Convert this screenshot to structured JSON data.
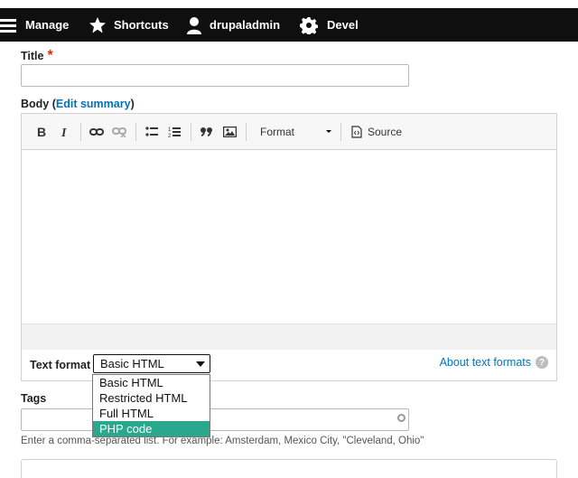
{
  "toolbar": {
    "manage": "Manage",
    "shortcuts": "Shortcuts",
    "user": "drupaladmin",
    "devel": "Devel"
  },
  "form": {
    "title_label": "Title",
    "required_mark": "*",
    "body_label": "Body",
    "edit_summary": "Edit summary",
    "editor": {
      "format_label": "Format",
      "source_label": "Source",
      "buttons": [
        "bold-icon",
        "italic-icon",
        "link-icon",
        "unlink-icon",
        "bulleted-list-icon",
        "numbered-list-icon",
        "blockquote-icon",
        "image-icon"
      ]
    },
    "text_format_label": "Text format",
    "text_format_value": "Basic HTML",
    "about_text_formats": "About text formats",
    "help_glyph": "?",
    "format_options": [
      "Basic HTML",
      "Restricted HTML",
      "Full HTML",
      "PHP code"
    ],
    "highlighted_option": "PHP code",
    "tags_label": "Tags",
    "tags_description": "Enter a comma-separated list. For example: Amsterdam, Mexico City, \"Cleveland, Ohio\""
  },
  "colors": {
    "toolbar_bg": "#0f0f0f",
    "link": "#0074bd",
    "required": "#e62600",
    "option_highlight": "#2aa88e"
  }
}
